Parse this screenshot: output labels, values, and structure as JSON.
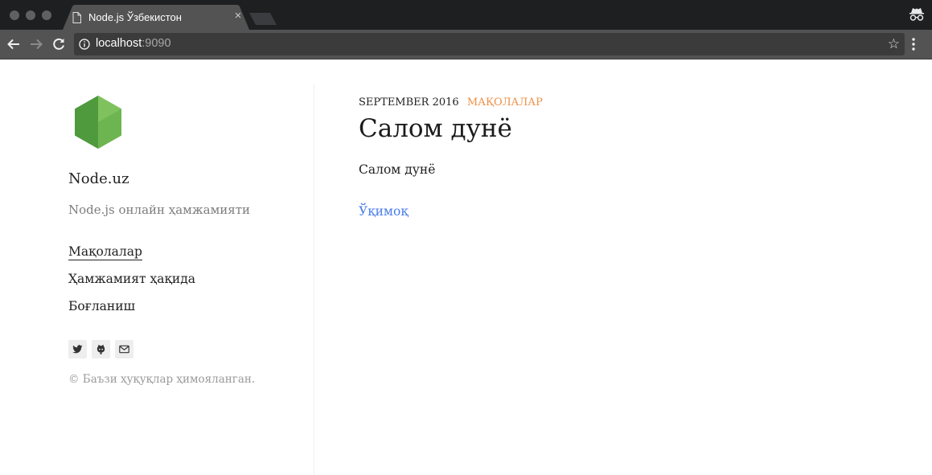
{
  "browser": {
    "tab_title": "Node.js Ўзбекистон",
    "tab_close": "×",
    "url_host": "localhost",
    "url_port": ":9090",
    "icons": [
      "page-icon",
      "close-icon",
      "incognito-icon",
      "back-arrow-icon",
      "forward-arrow-icon",
      "reload-icon",
      "info-icon",
      "star-icon",
      "menu-dots-icon"
    ]
  },
  "sidebar": {
    "site_title": "Node.uz",
    "tagline": "Node.js онлайн ҳамжамияти",
    "menu": [
      {
        "label": "Мақолалар",
        "active": true
      },
      {
        "label": "Ҳамжамият ҳақида",
        "active": false
      },
      {
        "label": "Боғланиш",
        "active": false
      }
    ],
    "social_icons": [
      "twitter-icon",
      "github-icon",
      "email-icon"
    ],
    "copyright": "© Баъзи ҳуқуқлар ҳимояланган."
  },
  "post": {
    "date": "SEPTEMBER 2016",
    "category": "МАҚОЛАЛАР",
    "title": "Салом дунё",
    "excerpt": "Салом дунё",
    "read_more": "Ўқимоқ"
  },
  "colors": {
    "accent_orange": "#ef8f45",
    "link_blue": "#4a7ee8",
    "node_green": "#6cb550"
  }
}
